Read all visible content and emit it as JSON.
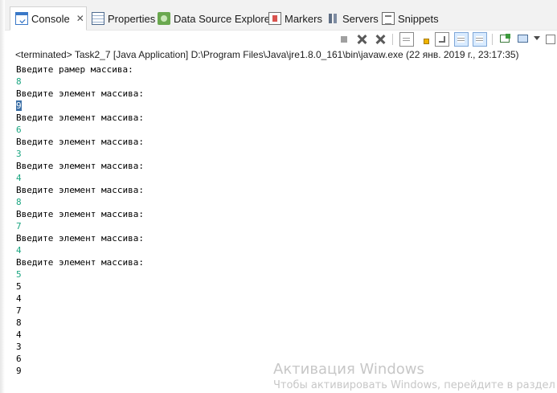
{
  "tabs": [
    {
      "label": "Console",
      "icon": "console-icon",
      "active": true,
      "close": "✕"
    },
    {
      "label": "Properties",
      "icon": "properties-icon"
    },
    {
      "label": "Data Source Explorer",
      "icon": "data-source-explorer-icon"
    },
    {
      "label": "Markers",
      "icon": "markers-icon"
    },
    {
      "label": "Servers",
      "icon": "servers-icon"
    },
    {
      "label": "Snippets",
      "icon": "snippets-icon"
    }
  ],
  "toolbar": {
    "buttons": [
      {
        "icon": "terminate-icon",
        "enabled": false
      },
      {
        "icon": "remove-launch-icon"
      },
      {
        "icon": "remove-all-terminated-icon"
      },
      {
        "icon": "scroll-lock-icon"
      },
      {
        "icon": "word-wrap-icon"
      },
      {
        "icon": "pin-console-icon"
      },
      {
        "icon": "show-console-on-stdout-icon",
        "pressed": true
      },
      {
        "icon": "show-console-on-stderr-icon",
        "pressed": true
      },
      {
        "icon": "open-console-icon"
      },
      {
        "icon": "display-selected-console-icon"
      },
      {
        "icon": "new-console-view-icon"
      }
    ]
  },
  "status_line": "<terminated> Task2_7 [Java Application] D:\\Program Files\\Java\\jre1.8.0_161\\bin\\javaw.exe (22 янв. 2019 г., 23:17:35)",
  "console_lines": [
    {
      "text": "Введите рамер массива:",
      "kind": "output"
    },
    {
      "text": "8",
      "kind": "input"
    },
    {
      "text": "Введите элемент массива:",
      "kind": "output"
    },
    {
      "text": "9",
      "kind": "input-selected"
    },
    {
      "text": "Введите элемент массива:",
      "kind": "output"
    },
    {
      "text": "6",
      "kind": "input"
    },
    {
      "text": "Введите элемент массива:",
      "kind": "output"
    },
    {
      "text": "3",
      "kind": "input"
    },
    {
      "text": "Введите элемент массива:",
      "kind": "output"
    },
    {
      "text": "4",
      "kind": "input"
    },
    {
      "text": "Введите элемент массива:",
      "kind": "output"
    },
    {
      "text": "8",
      "kind": "input"
    },
    {
      "text": "Введите элемент массива:",
      "kind": "output"
    },
    {
      "text": "7",
      "kind": "input"
    },
    {
      "text": "Введите элемент массива:",
      "kind": "output"
    },
    {
      "text": "4",
      "kind": "input"
    },
    {
      "text": "Введите элемент массива:",
      "kind": "output"
    },
    {
      "text": "5",
      "kind": "input"
    },
    {
      "text": "5",
      "kind": "output"
    },
    {
      "text": "4",
      "kind": "output"
    },
    {
      "text": "7",
      "kind": "output"
    },
    {
      "text": "8",
      "kind": "output"
    },
    {
      "text": "4",
      "kind": "output"
    },
    {
      "text": "3",
      "kind": "output"
    },
    {
      "text": "6",
      "kind": "output"
    },
    {
      "text": "9",
      "kind": "output"
    }
  ],
  "watermark": {
    "title": "Активация Windows",
    "subtitle": "Чтобы активировать Windows, перейдите в раздел"
  },
  "colors": {
    "input_text": "#1aa580",
    "output_text": "#000000",
    "selection": "#3a6ea5"
  }
}
